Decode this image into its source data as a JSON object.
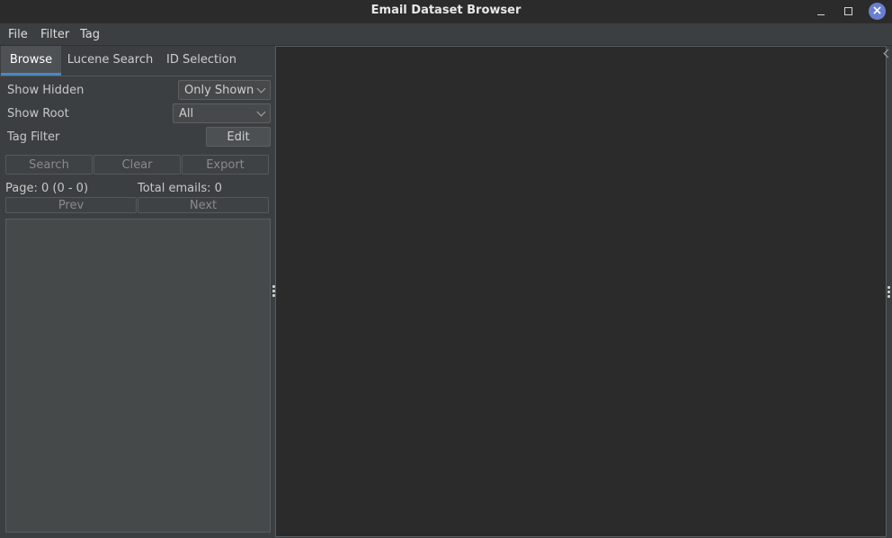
{
  "window": {
    "title": "Email Dataset Browser",
    "close_symbol": "×",
    "accent_color": "#6a7fcf"
  },
  "menu": {
    "items": [
      "File",
      "Filter",
      "Tag"
    ]
  },
  "tabs": {
    "items": [
      "Browse",
      "Lucene Search",
      "ID Selection"
    ],
    "active": "Browse"
  },
  "browse": {
    "show_hidden": {
      "label": "Show Hidden",
      "value": "Only Shown"
    },
    "show_root": {
      "label": "Show Root",
      "value": "All"
    },
    "tag_filter": {
      "label": "Tag Filter",
      "button": "Edit"
    },
    "actions": {
      "search": "Search",
      "clear": "Clear",
      "export": "Export"
    },
    "page_info": "Page: 0 (0 - 0)",
    "total_emails": "Total emails: 0",
    "pager": {
      "prev": "Prev",
      "next": "Next"
    }
  }
}
